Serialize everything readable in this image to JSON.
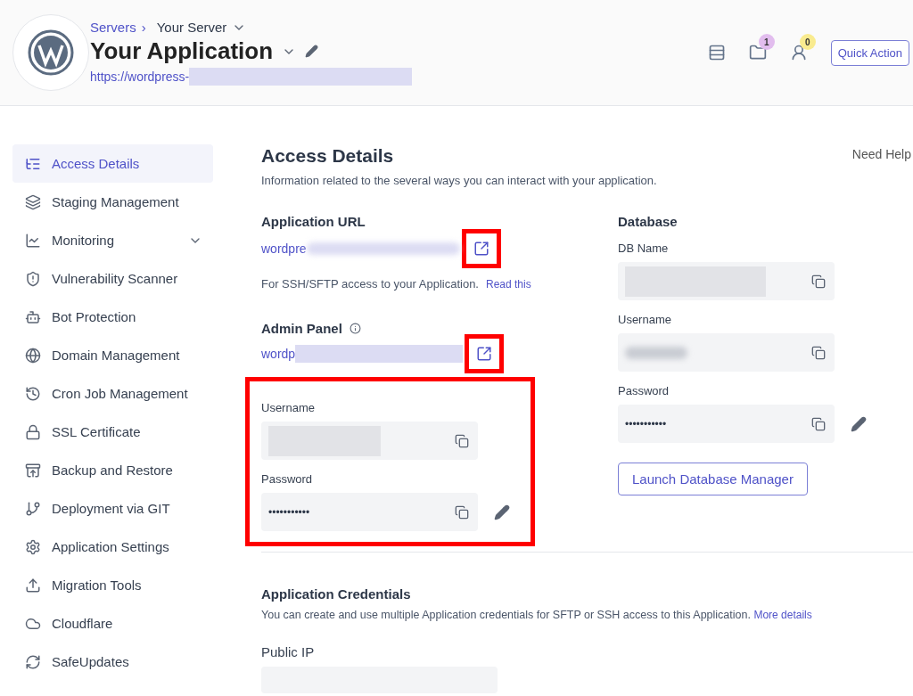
{
  "header": {
    "breadcrumb": {
      "parent": "Servers",
      "separator": "›",
      "current": "Your Server"
    },
    "title": "Your Application",
    "url": "https://wordpress-",
    "badges": [
      {
        "count": "1",
        "color": "#e2bdee"
      },
      {
        "count": "0",
        "color": "#f9eb8f"
      }
    ],
    "quick_action": "Quick Action"
  },
  "sidebar": {
    "items": [
      {
        "label": "Access Details",
        "selected": true,
        "expandable": false
      },
      {
        "label": "Staging Management",
        "selected": false,
        "expandable": false
      },
      {
        "label": "Monitoring",
        "selected": false,
        "expandable": true
      },
      {
        "label": "Vulnerability Scanner",
        "selected": false,
        "expandable": false
      },
      {
        "label": "Bot Protection",
        "selected": false,
        "expandable": false
      },
      {
        "label": "Domain Management",
        "selected": false,
        "expandable": false
      },
      {
        "label": "Cron Job Management",
        "selected": false,
        "expandable": false
      },
      {
        "label": "SSL Certificate",
        "selected": false,
        "expandable": false
      },
      {
        "label": "Backup and Restore",
        "selected": false,
        "expandable": false
      },
      {
        "label": "Deployment via GIT",
        "selected": false,
        "expandable": false
      },
      {
        "label": "Application Settings",
        "selected": false,
        "expandable": false
      },
      {
        "label": "Migration Tools",
        "selected": false,
        "expandable": false
      },
      {
        "label": "Cloudflare",
        "selected": false,
        "expandable": false
      },
      {
        "label": "SafeUpdates",
        "selected": false,
        "expandable": false
      }
    ]
  },
  "page": {
    "title": "Access Details",
    "description": "Information related to the several ways you can interact with your application.",
    "help": "Need Help"
  },
  "app_url": {
    "title": "Application URL",
    "link": "wordpre",
    "highlighted": true,
    "note": "For SSH/SFTP access to your Application.",
    "note_link": "Read this"
  },
  "admin_panel": {
    "title": "Admin Panel",
    "link": "wordp",
    "highlighted": true,
    "credentials_highlighted": true,
    "fields": [
      {
        "label": "Username",
        "kind": "redacted",
        "editable": false
      },
      {
        "label": "Password",
        "kind": "secret",
        "value": "•••••••••••",
        "editable": true
      }
    ]
  },
  "database": {
    "title": "Database",
    "fields": [
      {
        "label": "DB Name",
        "kind": "redacted",
        "editable": false
      },
      {
        "label": "Username",
        "kind": "blurred",
        "editable": false
      },
      {
        "label": "Password",
        "kind": "secret",
        "value": "•••••••••••",
        "editable": true
      }
    ],
    "button": "Launch Database Manager"
  },
  "credentials": {
    "title": "Application Credentials",
    "description": "You can create and use multiple Application credentials for SFTP or SSH access to this Application.",
    "link": "More details",
    "public_ip_label": "Public IP"
  }
}
